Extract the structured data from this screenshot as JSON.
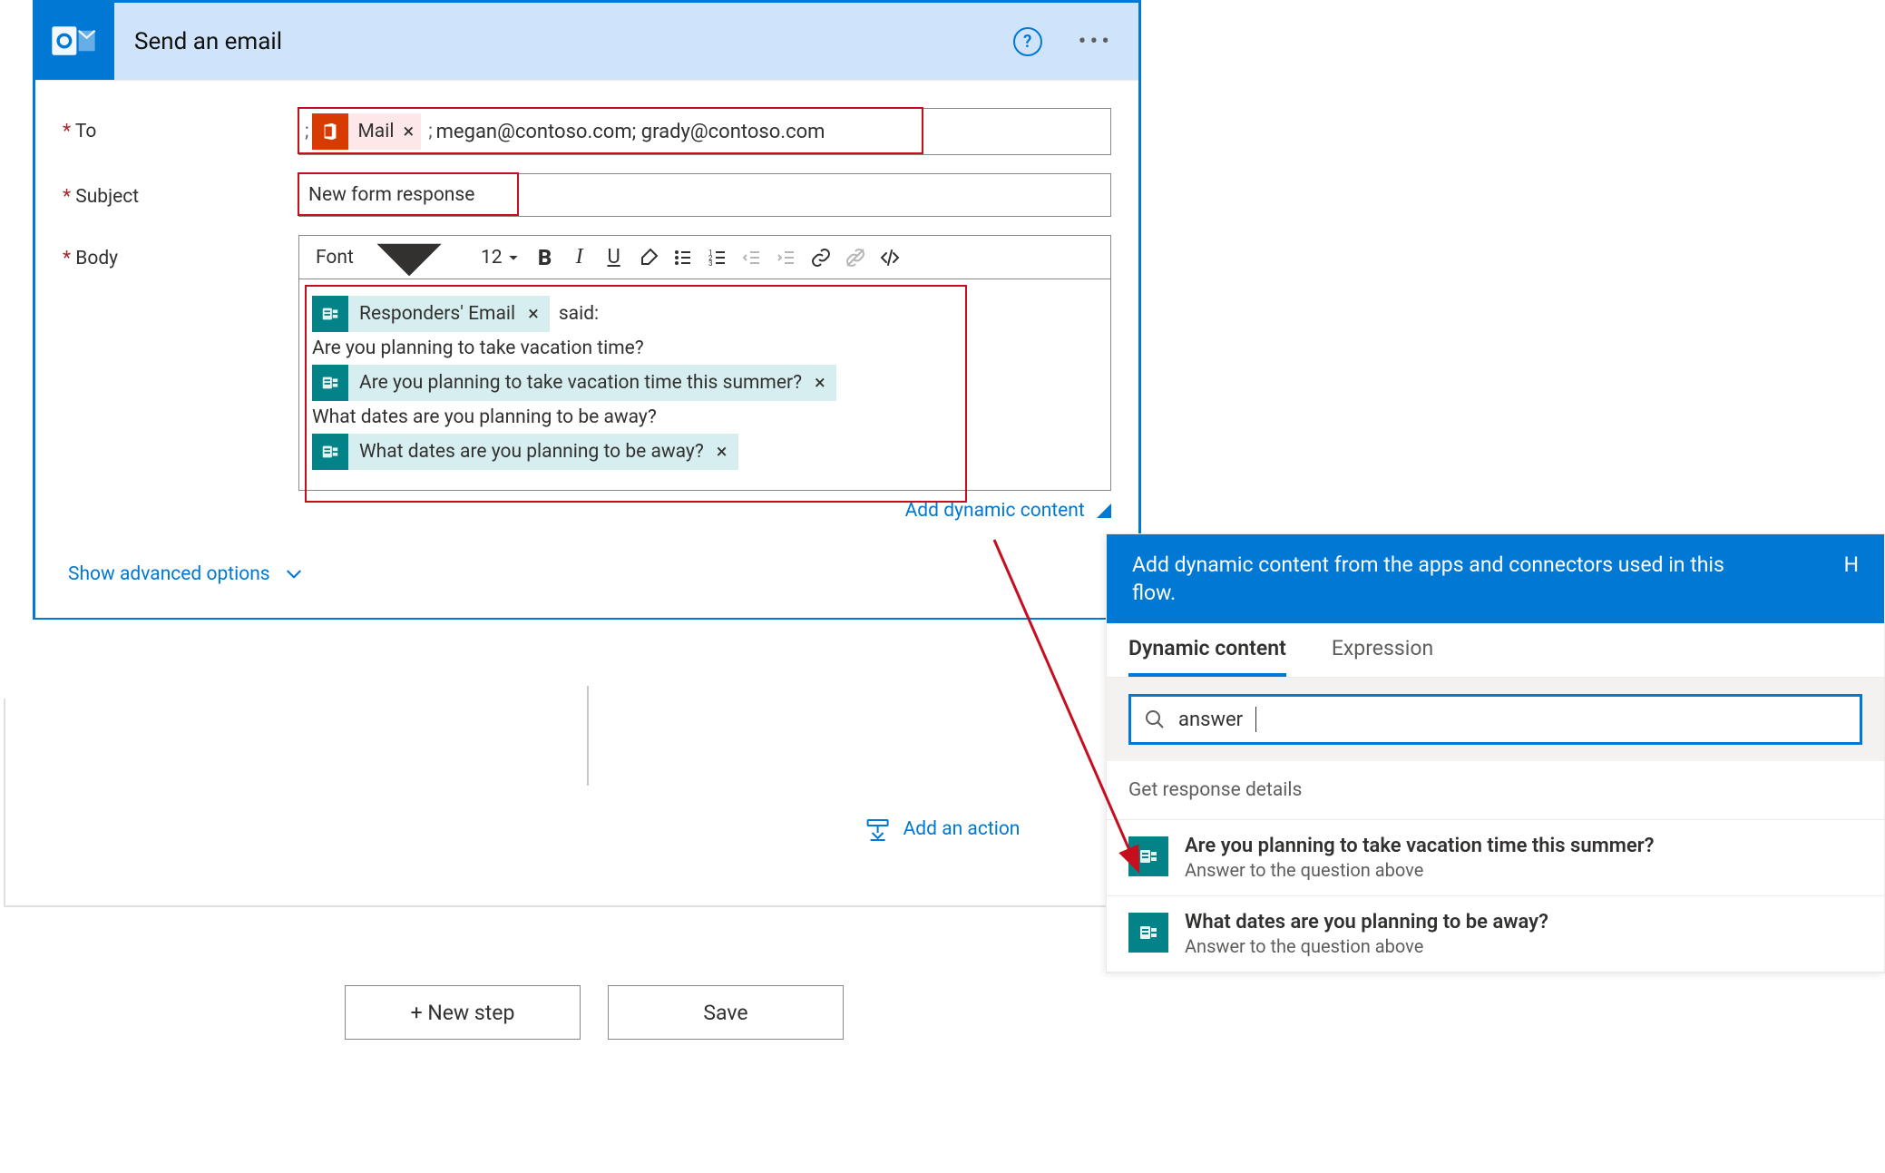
{
  "card": {
    "title": "Send an email",
    "fields": {
      "to": {
        "label": "To",
        "token": "Mail",
        "value": "megan@contoso.com; grady@contoso.com"
      },
      "subject": {
        "label": "Subject",
        "value": "New form response"
      },
      "body": {
        "label": "Body",
        "toolbar": {
          "font": "Font",
          "size": "12"
        },
        "line_said": "said:",
        "token_responder": "Responders' Email",
        "q1_text": "Are you planning to take vacation time?",
        "q1_token": "Are you planning to take vacation time this summer?",
        "q2_text": "What dates are you planning to be away?",
        "q2_token": "What dates are you planning to be away?"
      },
      "add_dynamic": "Add dynamic content"
    },
    "advanced": "Show advanced options",
    "add_action": "Add an action"
  },
  "buttons": {
    "new_step": "+ New step",
    "save": "Save"
  },
  "panel": {
    "header": "Add dynamic content from the apps and connectors used in this flow.",
    "header_link": "H",
    "tab_dynamic": "Dynamic content",
    "tab_expression": "Expression",
    "search": "answer",
    "group": "Get response details",
    "items": [
      {
        "title": "Are you planning to take vacation time this summer?",
        "sub": "Answer to the question above"
      },
      {
        "title": "What dates are you planning to be away?",
        "sub": "Answer to the question above"
      }
    ]
  }
}
